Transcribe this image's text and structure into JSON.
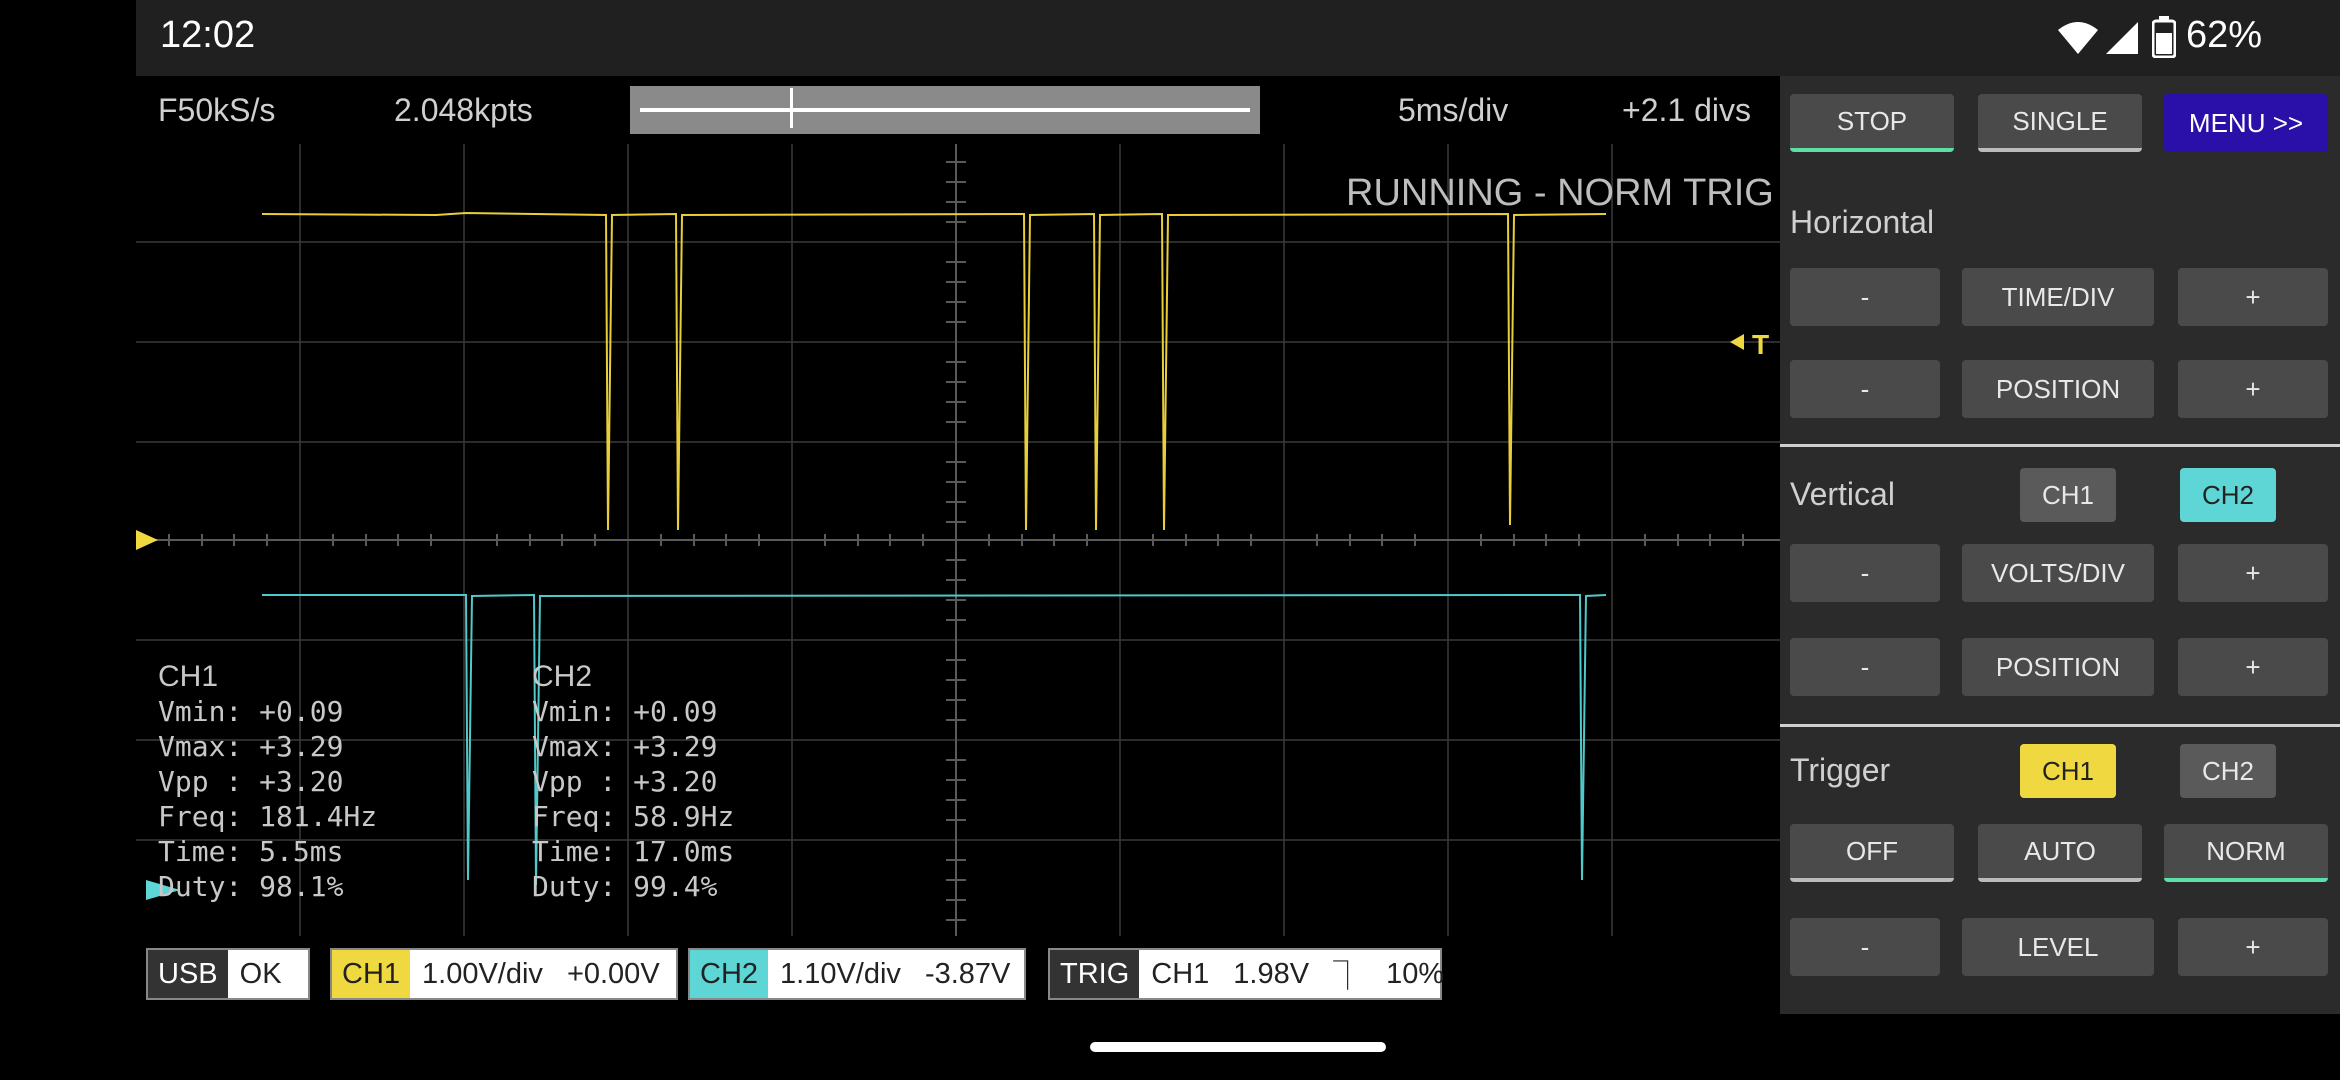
{
  "status_bar": {
    "time": "12:02",
    "battery": "62%"
  },
  "scope_header": {
    "sample_rate": "F50kS/s",
    "points": "2.048kpts",
    "time_div": "5ms/div",
    "offset": "+2.1 divs",
    "state": "RUNNING - NORM TRIG"
  },
  "trigger_marker": "T",
  "measurements": {
    "ch1": {
      "title": "CH1",
      "lines": [
        "Vmin: +0.09",
        "Vmax: +3.29",
        "Vpp : +3.20",
        "Freq: 181.4Hz",
        "Time: 5.5ms",
        "Duty: 98.1%"
      ]
    },
    "ch2": {
      "title": "CH2",
      "lines": [
        "Vmin: +0.09",
        "Vmax: +3.29",
        "Vpp : +3.20",
        "Freq: 58.9Hz",
        "Time: 17.0ms",
        "Duty: 99.4%"
      ]
    }
  },
  "status_boxes": {
    "usb": {
      "tag": "USB",
      "value": "OK"
    },
    "ch1": {
      "tag": "CH1",
      "scale": "1.00V/div",
      "offset": "+0.00V"
    },
    "ch2": {
      "tag": "CH2",
      "scale": "1.10V/div",
      "offset": "-3.87V"
    },
    "trig": {
      "tag": "TRIG",
      "source": "CH1",
      "level": "1.98V",
      "edge": "⏋",
      "position": "10%"
    }
  },
  "panel": {
    "stop": "STOP",
    "single": "SINGLE",
    "menu": "MENU >>",
    "horizontal": {
      "title": "Horizontal",
      "minus": "-",
      "time_div": "TIME/DIV",
      "plus": "+",
      "position": "POSITION"
    },
    "vertical": {
      "title": "Vertical",
      "ch1": "CH1",
      "ch2": "CH2",
      "minus": "-",
      "volts_div": "VOLTS/DIV",
      "plus": "+",
      "position": "POSITION"
    },
    "trigger": {
      "title": "Trigger",
      "ch1": "CH1",
      "ch2": "CH2",
      "off": "OFF",
      "auto": "AUTO",
      "norm": "NORM",
      "minus": "-",
      "level": "LEVEL",
      "plus": "+"
    }
  },
  "colors": {
    "ch1": "#f0d840",
    "ch2": "#5fd6d6",
    "menu": "#2a0fa8",
    "grid": "#3a3a3a"
  },
  "icons": [
    "wifi-icon",
    "signal-icon",
    "battery-icon"
  ]
}
